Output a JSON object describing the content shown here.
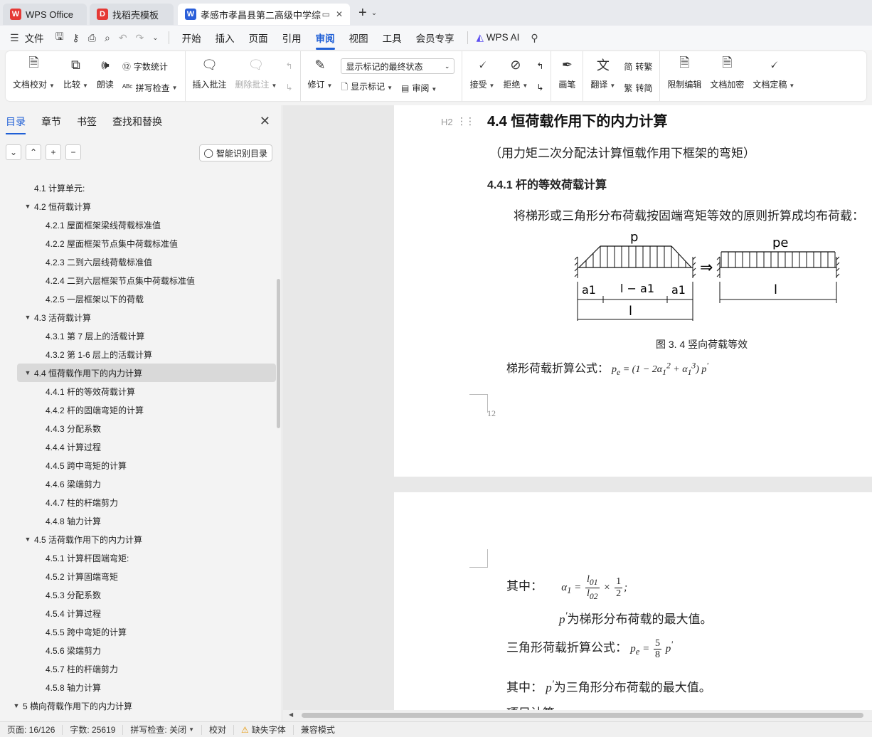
{
  "tabs": [
    {
      "label": "WPS Office",
      "logo": "W"
    },
    {
      "label": "找稻壳模板",
      "logo": "D"
    },
    {
      "label": "孝感市孝昌县第二高级中学综",
      "logo": "W"
    }
  ],
  "menu": {
    "file": "文件",
    "items": [
      "开始",
      "插入",
      "页面",
      "引用",
      "审阅",
      "视图",
      "工具",
      "会员专享"
    ],
    "active": "审阅",
    "ai": "WPS AI"
  },
  "ribbon": {
    "proofread": "文档校对",
    "compare": "比较",
    "read_aloud": "朗读",
    "word_count": "字数统计",
    "spell_check": "拼写检查",
    "insert_comment": "插入批注",
    "delete_comment": "删除批注",
    "revise": "修订",
    "markup_state": "显示标记的最终状态",
    "show_markup": "显示标记",
    "review": "审阅",
    "accept": "接受",
    "reject": "拒绝",
    "pen": "画笔",
    "translate": "翻译",
    "to_traditional": "转繁",
    "to_simplified": "转简",
    "restrict_edit": "限制编辑",
    "encrypt": "文档加密",
    "finalize": "文档定稿"
  },
  "sidebar": {
    "tabs": [
      "目录",
      "章节",
      "书签",
      "查找和替换"
    ],
    "smart_toc": "智能识别目录",
    "toc": [
      {
        "label": "4.1 计算单元:",
        "level": 1,
        "arrow": false
      },
      {
        "label": "4.2 恒荷载计算",
        "level": 1,
        "arrow": true
      },
      {
        "label": "4.2.1 屋面框架梁线荷载标准值",
        "level": 2,
        "arrow": false
      },
      {
        "label": "4.2.2 屋面框架节点集中荷载标准值",
        "level": 2,
        "arrow": false
      },
      {
        "label": "4.2.3  二到六层线荷载标准值",
        "level": 2,
        "arrow": false
      },
      {
        "label": "4.2.4 二到六层框架节点集中荷载标准值",
        "level": 2,
        "arrow": false
      },
      {
        "label": "4.2.5 一层框架以下的荷载",
        "level": 2,
        "arrow": false
      },
      {
        "label": "4.3 活荷载计算",
        "level": 1,
        "arrow": true
      },
      {
        "label": "4.3.1 第 7 层上的活载计算",
        "level": 2,
        "arrow": false
      },
      {
        "label": "4.3.2 第 1-6 层上的活载计算",
        "level": 2,
        "arrow": false
      },
      {
        "label": "4.4 恒荷载作用下的内力计算",
        "level": 1,
        "arrow": true,
        "selected": true
      },
      {
        "label": "4.4.1 杆的等效荷载计算",
        "level": 2,
        "arrow": false
      },
      {
        "label": "4.4.2 杆的固端弯矩的计算",
        "level": 2,
        "arrow": false
      },
      {
        "label": "4.4.3 分配系数",
        "level": 2,
        "arrow": false
      },
      {
        "label": "4.4.4 计算过程",
        "level": 2,
        "arrow": false
      },
      {
        "label": "4.4.5 跨中弯矩的计算",
        "level": 2,
        "arrow": false
      },
      {
        "label": "4.4.6 梁端剪力",
        "level": 2,
        "arrow": false
      },
      {
        "label": "4.4.7 柱的杆端剪力",
        "level": 2,
        "arrow": false
      },
      {
        "label": "4.4.8 轴力计算",
        "level": 2,
        "arrow": false
      },
      {
        "label": "4.5 活荷载作用下的内力计算",
        "level": 1,
        "arrow": true
      },
      {
        "label": "4.5.1 计算杆固端弯矩:",
        "level": 2,
        "arrow": false
      },
      {
        "label": "4.5.2 计算固端弯矩",
        "level": 2,
        "arrow": false
      },
      {
        "label": "4.5.3 分配系数",
        "level": 2,
        "arrow": false
      },
      {
        "label": "4.5.4 计算过程",
        "level": 2,
        "arrow": false
      },
      {
        "label": "4.5.5 跨中弯矩的计算",
        "level": 2,
        "arrow": false
      },
      {
        "label": "4.5.6 梁端剪力",
        "level": 2,
        "arrow": false
      },
      {
        "label": "4.5.7 柱的杆端剪力",
        "level": 2,
        "arrow": false
      },
      {
        "label": "4.5.8 轴力计算",
        "level": 2,
        "arrow": false
      },
      {
        "label": "5  横向荷载作用下的内力计算",
        "level": 0,
        "arrow": true
      }
    ]
  },
  "doc": {
    "h2_marker": "H2",
    "heading": "4.4 恒荷载作用下的内力计算",
    "subtitle": "（用力矩二次分配法计算恒载作用下框架的弯矩）",
    "heading_441": "4.4.1 杆的等效荷载计算",
    "para": "将梯形或三角形分布荷载按固端弯矩等效的原则折算成均布荷载：",
    "figure_labels": {
      "p": "p",
      "pe": "pe",
      "a1": "a1",
      "l_minus_a1": "l − a1",
      "l": "l"
    },
    "figure_caption": "图 3. 4 竖向荷载等效",
    "formula1_label": "梯形荷载折算公式：",
    "page_number": "12",
    "where_label": "其中：",
    "p_desc": "为梯形分布荷载的最大值。",
    "tri_label": "三角形荷载折算公式：",
    "tri_where": "其中：",
    "tri_desc": "为三角形分布荷载的最大值。",
    "cut_line": "项目计算"
  },
  "status": {
    "page": "页面: 16/126",
    "words": "字数: 25619",
    "spell": "拼写检查: 关闭",
    "proof": "校对",
    "missing_font": "缺失字体",
    "compat": "兼容模式"
  }
}
